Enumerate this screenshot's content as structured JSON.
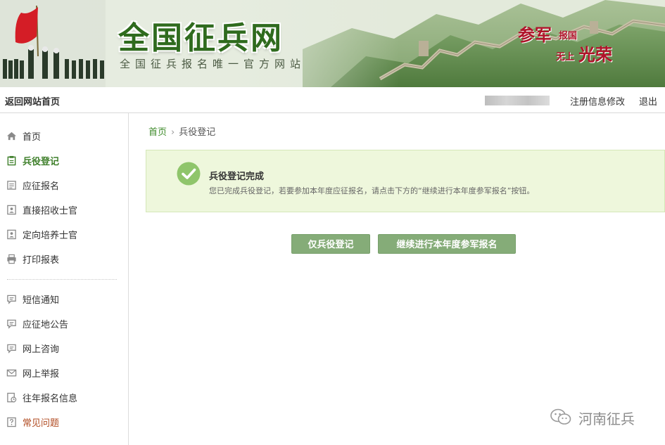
{
  "banner": {
    "title": "全国征兵网",
    "subtitle": "全国征兵报名唯一官方网站",
    "slogan": [
      "参军",
      "报国",
      "无上",
      "光荣"
    ]
  },
  "topbar": {
    "back_label": "返回网站首页",
    "edit_label": "注册信息修改",
    "logout_label": "退出"
  },
  "sidebar": {
    "items": [
      {
        "label": "首页",
        "icon": "home-icon"
      },
      {
        "label": "兵役登记",
        "icon": "clipboard-icon",
        "active": true
      },
      {
        "label": "应征报名",
        "icon": "form-icon"
      },
      {
        "label": "直接招收士官",
        "icon": "id-card-icon"
      },
      {
        "label": "定向培养士官",
        "icon": "id-card-icon"
      },
      {
        "label": "打印报表",
        "icon": "printer-icon"
      },
      {
        "label": "短信通知",
        "icon": "message-icon"
      },
      {
        "label": "应征地公告",
        "icon": "message-icon"
      },
      {
        "label": "网上咨询",
        "icon": "message-icon"
      },
      {
        "label": "网上举报",
        "icon": "mail-icon"
      },
      {
        "label": "往年报名信息",
        "icon": "history-icon"
      },
      {
        "label": "常见问题",
        "icon": "question-icon"
      }
    ]
  },
  "breadcrumb": {
    "home": "首页",
    "separator": "›",
    "current": "兵役登记"
  },
  "notice": {
    "title": "兵役登记完成",
    "description": "您已完成兵役登记，若要参加本年度应征报名，请点击下方的“继续进行本年度参军报名”按钮。"
  },
  "buttons": {
    "reg_only": "仅兵役登记",
    "continue": "继续进行本年度参军报名"
  },
  "watermark": {
    "text": "河南征兵"
  },
  "colors": {
    "accent_green": "#3e7f2a",
    "button_green": "#85ac78",
    "notice_bg": "#eef7dc",
    "check_green": "#8fc56b",
    "faq_text": "#b04a20"
  }
}
